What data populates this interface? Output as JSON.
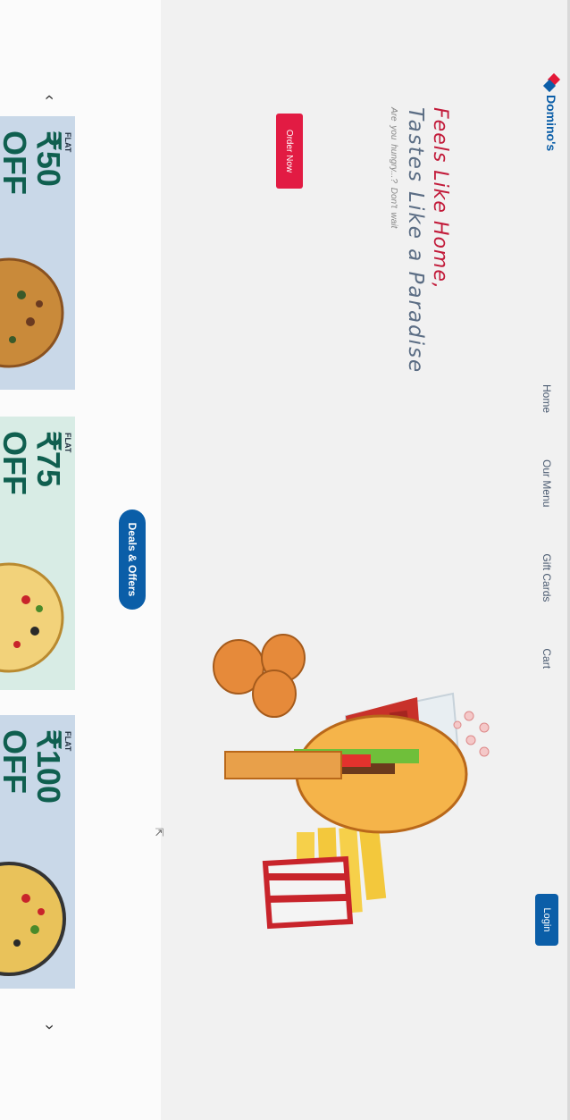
{
  "nav": {
    "logo_text": "Domino's",
    "links": [
      "Home",
      "Our Menu",
      "Gift Cards",
      "Cart"
    ],
    "login": "Login"
  },
  "hero": {
    "line1": "Feels Like Home,",
    "line2": "Tastes Like a Paradise",
    "sub": "Are you hungry...?   Don't wait",
    "order_btn": "Order Now"
  },
  "deals_btn": "Deals & Offers",
  "offers": [
    {
      "flat": "FLAT",
      "amount": "₹50",
      "off": "OFF",
      "bg": "#c9d8e8"
    },
    {
      "flat": "FLAT",
      "amount": "₹75",
      "off": "OFF",
      "bg": "#d8ece5"
    },
    {
      "flat": "FLAT",
      "amount": "₹100",
      "off": "OFF",
      "bg": "#c9d8e8"
    }
  ],
  "colors": {
    "brand_blue": "#0b5ea8",
    "brand_red": "#e21b43",
    "offer_green": "#0f5f4f"
  },
  "icons": {
    "prev": "chevron-left-icon",
    "next": "chevron-right-icon"
  }
}
